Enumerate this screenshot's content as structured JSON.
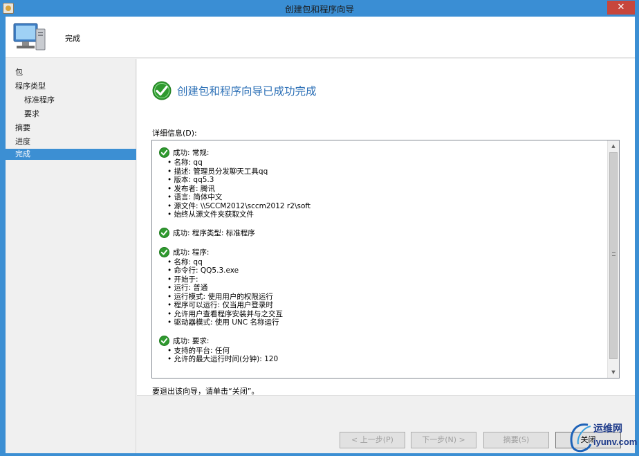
{
  "window": {
    "title": "创建包和程序向导",
    "close_glyph": "✕"
  },
  "header": {
    "title": "完成",
    "icon": "computer-monitor-icon"
  },
  "sidebar": {
    "items": [
      {
        "label": "包"
      },
      {
        "label": "程序类型"
      },
      {
        "label": "标准程序"
      },
      {
        "label": "要求"
      },
      {
        "label": "摘要"
      },
      {
        "label": "进度"
      },
      {
        "label": "完成"
      }
    ],
    "active": "完成"
  },
  "main": {
    "heading": "创建包和程序向导已成功完成",
    "details_label": "详细信息(D):",
    "groups": [
      {
        "head": "成功: 常规:",
        "items": [
          "名称: qq",
          "描述: 管理员分发聊天工具qq",
          "版本: qq5.3",
          "发布者: 腾讯",
          "语言: 简体中文",
          "源文件: \\\\SCCM2012\\sccm2012 r2\\soft",
          "始终从源文件夹获取文件"
        ]
      },
      {
        "head": "成功: 程序类型: 标准程序",
        "items": []
      },
      {
        "head": "成功: 程序:",
        "items": [
          "名称: qq",
          "命令行: QQ5.3.exe",
          "开始于:",
          "运行: 普通",
          "运行模式: 使用用户的权限运行",
          "程序可以运行: 仅当用户登录时",
          "允许用户查看程序安装并与之交互",
          "驱动器模式: 使用 UNC 名称运行"
        ]
      },
      {
        "head": "成功: 要求:",
        "items": [
          "支持的平台: 任何",
          "允许的最大运行时间(分钟): 120"
        ]
      }
    ],
    "exit_hint": "要退出该向导，请单击“关闭”。"
  },
  "footer": {
    "prev_label": "< 上一步(P)",
    "next_label": "下一步(N) >",
    "summary_label": "摘要(S)",
    "close_label": "关闭"
  },
  "watermark": {
    "text1": "运维网",
    "text2": "iyunv.com"
  },
  "colors": {
    "accent": "#3c8fd3",
    "heading": "#2b6fb6",
    "success": "#2f9a2f"
  }
}
